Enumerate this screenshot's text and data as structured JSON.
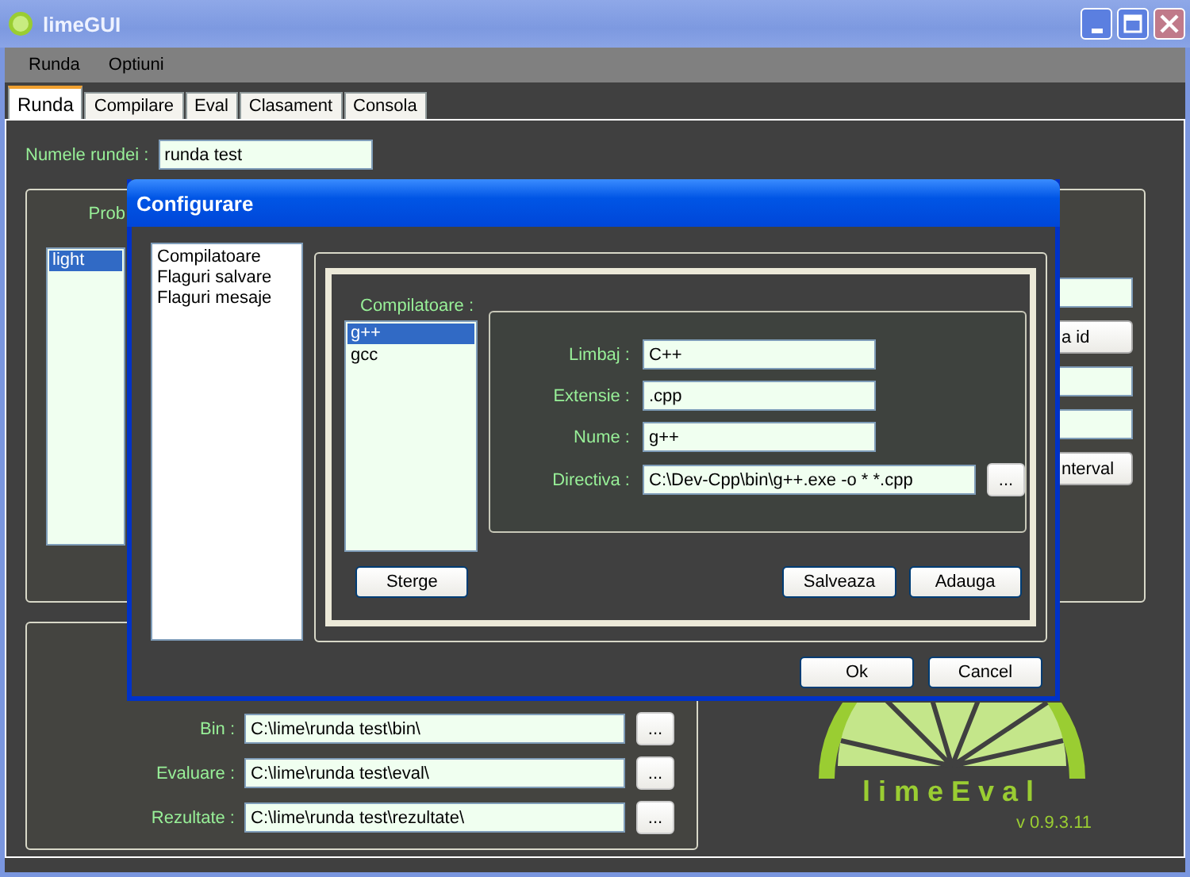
{
  "window": {
    "title": "limeGUI"
  },
  "menu": [
    "Runda",
    "Optiuni"
  ],
  "tabs": [
    {
      "label": "Runda",
      "selected": true
    },
    {
      "label": "Compilare",
      "selected": false
    },
    {
      "label": "Eval",
      "selected": false
    },
    {
      "label": "Clasament",
      "selected": false
    },
    {
      "label": "Consola",
      "selected": false
    }
  ],
  "round_name": {
    "label": "Numele rundei :",
    "value": "runda test"
  },
  "problems": {
    "label": "Prob",
    "items": [
      {
        "label": "light",
        "selected": true
      }
    ]
  },
  "right_controls": [
    {
      "kind": "field"
    },
    {
      "kind": "button",
      "label": "a id"
    },
    {
      "kind": "field"
    },
    {
      "kind": "field"
    },
    {
      "kind": "button",
      "label": "nterval"
    }
  ],
  "folders": [
    {
      "label": "Bin :",
      "value": "C:\\lime\\runda test\\bin\\",
      "button": "..."
    },
    {
      "label": "Evaluare :",
      "value": "C:\\lime\\runda test\\eval\\",
      "button": "..."
    },
    {
      "label": "Rezultate :",
      "value": "C:\\lime\\runda test\\rezultate\\",
      "button": "..."
    }
  ],
  "logo": {
    "text": "limeEval",
    "version": "v 0.9.3.11"
  },
  "dialog": {
    "title": "Configurare",
    "categories": [
      {
        "label": "Compilatoare"
      },
      {
        "label": "Flaguri salvare"
      },
      {
        "label": "Flaguri mesaje"
      }
    ],
    "compilers_label": "Compilatoare :",
    "compilers": [
      {
        "label": "g++",
        "selected": true
      },
      {
        "label": "gcc",
        "selected": false
      }
    ],
    "fields": [
      {
        "label": "Limbaj :",
        "value": "C++"
      },
      {
        "label": "Extensie :",
        "value": ".cpp"
      },
      {
        "label": "Nume :",
        "value": "g++"
      },
      {
        "label": "Directiva :",
        "value": "C:\\Dev-Cpp\\bin\\g++.exe -o * *.cpp",
        "button": "..."
      }
    ],
    "delete_button": "Sterge",
    "save_button": "Salveaza",
    "add_button": "Adauga",
    "ok_button": "Ok",
    "cancel_button": "Cancel"
  }
}
